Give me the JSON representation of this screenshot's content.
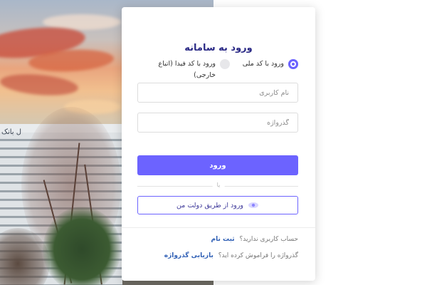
{
  "page": {
    "title": "ورود به سامانه"
  },
  "login_type": {
    "options": [
      {
        "label": "ورود با کد ملی",
        "selected": true
      },
      {
        "label": "ورود با کد فیدا (اتباع خارجی)",
        "selected": false
      }
    ]
  },
  "form": {
    "username_placeholder": "نام کاربری",
    "password_placeholder": "گذرواژه",
    "submit_label": "ورود",
    "divider_text": "یا",
    "gov_login_label": "ورود از طریق دولت من"
  },
  "footer": {
    "no_account_text": "حساب کاربری ندارید؟",
    "register_link": "ثبت نام",
    "forgot_text": "گذرواژه را فراموش کرده اید؟",
    "recover_link": "بازیابی گذرواژه"
  },
  "background": {
    "sign_text": "ل بانک"
  },
  "colors": {
    "accent": "#6c63ff",
    "title": "#2b2a86",
    "link": "#2f5fb5"
  }
}
